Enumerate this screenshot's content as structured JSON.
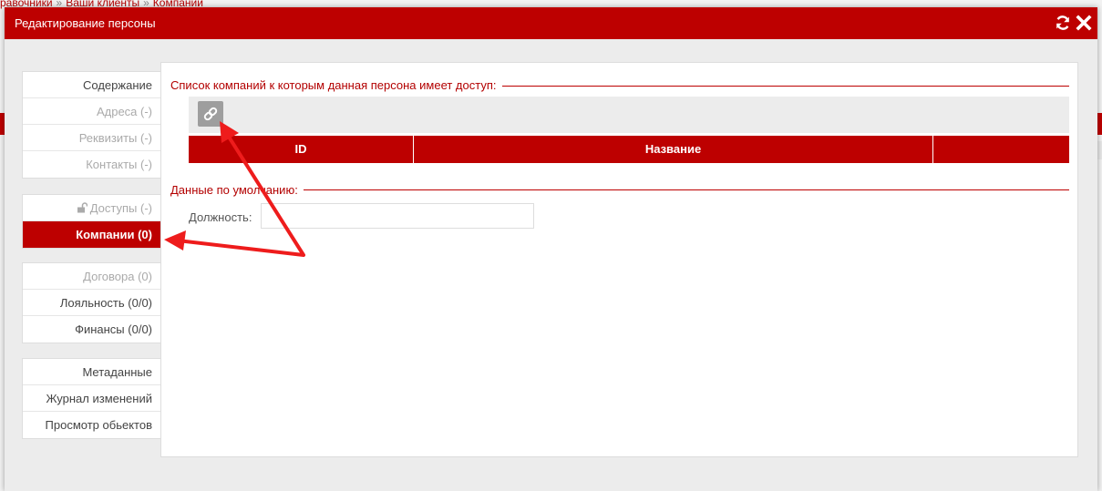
{
  "background": {
    "breadcrumb": [
      "равочники",
      "Ваши клиенты",
      "Компании"
    ],
    "breadcrumb_separator": "»"
  },
  "modal": {
    "title": "Редактирование персоны",
    "refresh_icon": "refresh-icon",
    "close_icon": "close-icon"
  },
  "sidebar": {
    "groups": [
      [
        {
          "label": "Содержание",
          "state": "normal"
        },
        {
          "label": "Адреса (-)",
          "state": "disabled"
        },
        {
          "label": "Реквизиты (-)",
          "state": "disabled"
        },
        {
          "label": "Контакты (-)",
          "state": "disabled"
        }
      ],
      [
        {
          "label": "Доступы (-)",
          "state": "disabled",
          "icon": "unlock-icon"
        },
        {
          "label": "Компании (0)",
          "state": "active"
        }
      ],
      [
        {
          "label": "Договора (0)",
          "state": "disabled"
        },
        {
          "label": "Лояльность (0/0)",
          "state": "normal"
        },
        {
          "label": "Финансы (0/0)",
          "state": "normal"
        }
      ],
      [
        {
          "label": "Метаданные",
          "state": "normal"
        },
        {
          "label": "Журнал изменений",
          "state": "normal"
        },
        {
          "label": "Просмотр обьектов",
          "state": "normal"
        }
      ]
    ]
  },
  "content": {
    "companies_legend": "Список компаний к которым данная персона имеет доступ:",
    "link_button_icon": "link-icon",
    "table_headers": [
      "ID",
      "Название",
      ""
    ],
    "defaults_legend": "Данные по умолчанию:",
    "position_label": "Должность:",
    "position_value": ""
  },
  "colors": {
    "brand_red": "#bd0000",
    "arrow_red": "#ee1c1c"
  }
}
